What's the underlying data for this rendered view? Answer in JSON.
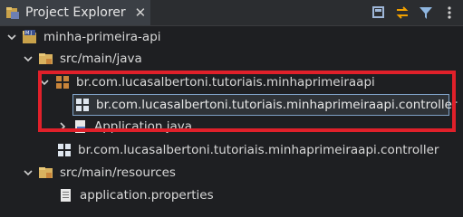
{
  "view": {
    "title": "Project Explorer",
    "close_symbol": "✕",
    "toolbar": [
      {
        "name": "collapse-all-icon",
        "color": "#9fb7d8"
      },
      {
        "name": "link-with-editor-icon",
        "color": "#f0a000"
      },
      {
        "name": "filter-icon",
        "color": "#8fb6e0"
      },
      {
        "name": "view-menu-icon",
        "color": "#d0d0d0"
      }
    ]
  },
  "tree": {
    "project": {
      "label": "minha-primeira-api",
      "expanded": true
    },
    "src_main_java": {
      "label": "src/main/java",
      "expanded": true
    },
    "package_main": {
      "label": "br.com.lucasalbertoni.tutoriais.minhaprimeiraapi",
      "expanded": true
    },
    "package_controller_renaming": {
      "label": "br.com.lucasalbertoni.tutoriais.minhaprimeiraapi.controller",
      "selected": true
    },
    "application_java": {
      "label": "Application.java",
      "expanded": false
    },
    "package_controller": {
      "label": "br.com.lucasalbertoni.tutoriais.minhaprimeiraapi.controller"
    },
    "src_main_resources": {
      "label": "src/main/resources",
      "expanded": true
    },
    "application_properties": {
      "label": "application.properties"
    }
  },
  "colors": {
    "highlight_box": "#e0202a",
    "selection_border": "#7fa2c7",
    "package_icon": "#c8843a",
    "folder_icon": "#d9b25f"
  }
}
